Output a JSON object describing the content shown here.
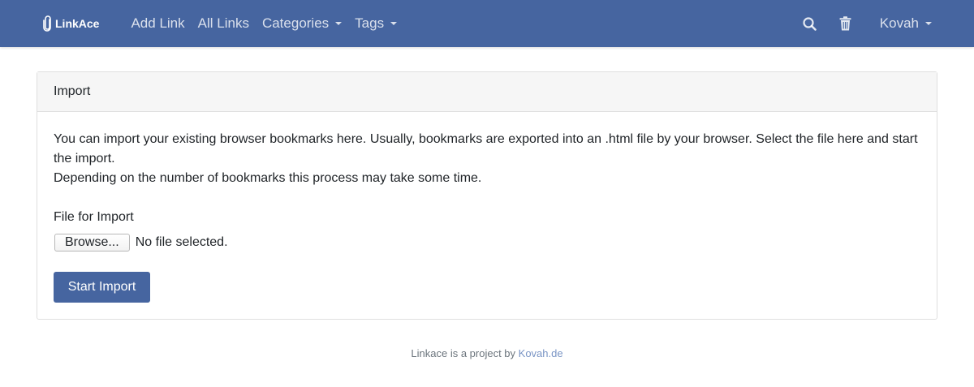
{
  "navbar": {
    "brand": "LinkAce",
    "links": [
      {
        "label": "Add Link"
      },
      {
        "label": "All Links"
      },
      {
        "label": "Categories"
      },
      {
        "label": "Tags"
      }
    ],
    "user": "Kovah",
    "icons": [
      "paperclip-icon",
      "search-icon",
      "trash-icon"
    ],
    "background": "#4665a0"
  },
  "card": {
    "title": "Import",
    "intro_line1": "You can import your existing browser bookmarks here. Usually, bookmarks are exported into an .html file by your browser. Select the file here and start the import.",
    "intro_line2": "Depending on the number of bookmarks this process may take some time.",
    "file_label": "File for Import",
    "browse_label": "Browse...",
    "file_status": "No file selected.",
    "submit_label": "Start Import"
  },
  "footer": {
    "text": "Linkace is a project by",
    "link": "Kovah.de"
  }
}
